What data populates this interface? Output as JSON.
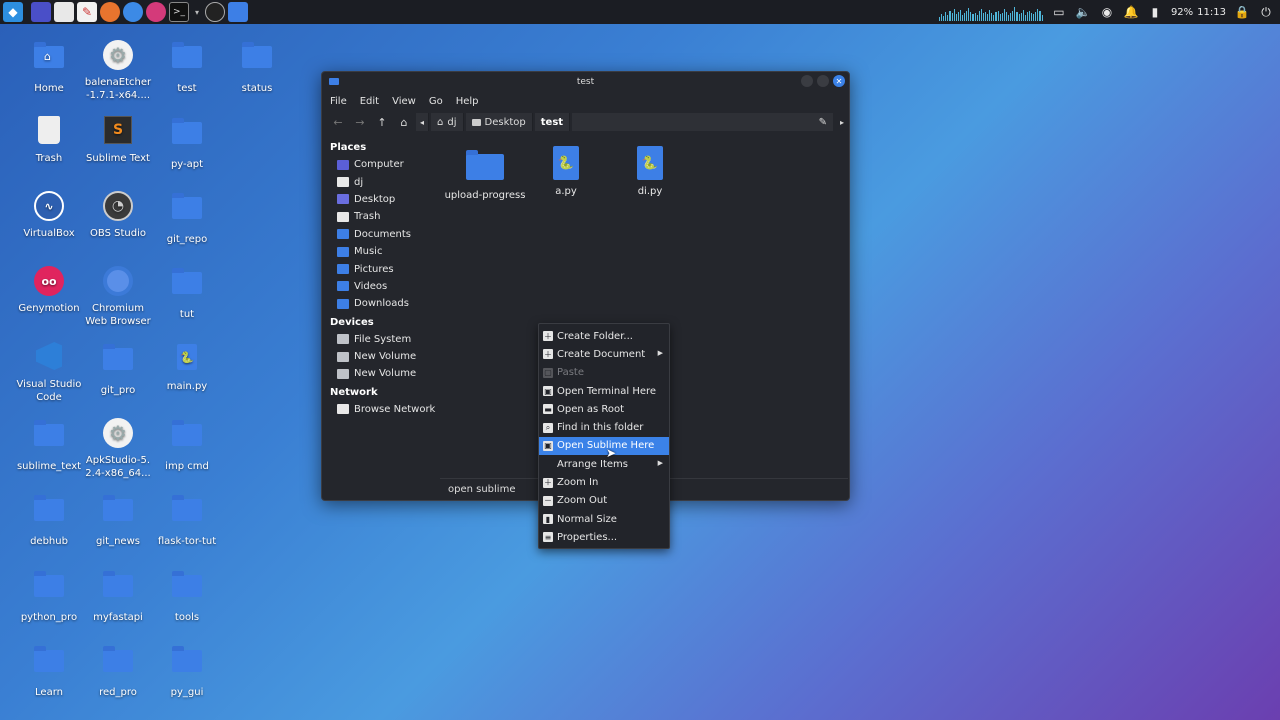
{
  "panel": {
    "launchers": [
      "start-menu-icon",
      "workspace-icon",
      "file-manager-icon",
      "text-editor-icon",
      "firefox-icon",
      "chromium-icon",
      "firefox-dev-icon",
      "terminal-icon",
      "chevron-down-icon",
      "obs-icon",
      "folder-icon"
    ],
    "battery": "92%",
    "time": "11:13"
  },
  "desktop": {
    "icons": [
      {
        "label": "Home",
        "type": "home-folder"
      },
      {
        "label": "balenaEtcher\n-1.7.1-x64....",
        "type": "gear"
      },
      {
        "label": "test",
        "type": "folder"
      },
      {
        "label": "status",
        "type": "folder"
      },
      {
        "label": "Trash",
        "type": "trash"
      },
      {
        "label": "Sublime Text",
        "type": "sublime"
      },
      {
        "label": "py-apt",
        "type": "folder"
      },
      {
        "label": "VirtualBox",
        "type": "virtualbox"
      },
      {
        "label": "OBS Studio",
        "type": "obs"
      },
      {
        "label": "git_repo",
        "type": "folder"
      },
      {
        "label": "Genymotion",
        "type": "genymotion"
      },
      {
        "label": "Chromium\nWeb Browser",
        "type": "chromium"
      },
      {
        "label": "tut",
        "type": "folder"
      },
      {
        "label": "Visual Studio\nCode",
        "type": "vscode"
      },
      {
        "label": "git_pro",
        "type": "folder"
      },
      {
        "label": "main.py",
        "type": "python"
      },
      {
        "label": "sublime_text",
        "type": "folder"
      },
      {
        "label": "ApkStudio-5.\n2.4-x86_64...",
        "type": "gear"
      },
      {
        "label": "imp cmd",
        "type": "folder"
      },
      {
        "label": "debhub",
        "type": "folder"
      },
      {
        "label": "git_news",
        "type": "folder"
      },
      {
        "label": "flask-tor-tut",
        "type": "folder"
      },
      {
        "label": "python_pro",
        "type": "folder"
      },
      {
        "label": "myfastapi",
        "type": "folder"
      },
      {
        "label": "tools",
        "type": "folder"
      },
      {
        "label": "Learn",
        "type": "folder"
      },
      {
        "label": "red_pro",
        "type": "folder"
      },
      {
        "label": "py_gui",
        "type": "folder"
      }
    ]
  },
  "window": {
    "title": "test",
    "menu": [
      "File",
      "Edit",
      "View",
      "Go",
      "Help"
    ],
    "breadcrumbs": [
      "dj",
      "Desktop",
      "test"
    ],
    "sidebar": {
      "places_heading": "Places",
      "places": [
        "Computer",
        "dj",
        "Desktop",
        "Trash",
        "Documents",
        "Music",
        "Pictures",
        "Videos",
        "Downloads"
      ],
      "devices_heading": "Devices",
      "devices": [
        "File System",
        "New Volume",
        "New Volume"
      ],
      "network_heading": "Network",
      "network": [
        "Browse Network"
      ]
    },
    "files": [
      "upload-progress",
      "a.py",
      "di.py"
    ],
    "status_text": "open sublime"
  },
  "context_menu": {
    "items": [
      {
        "label": "Create Folder...",
        "icon": "plus-icon",
        "state": "normal"
      },
      {
        "label": "Create Document",
        "icon": "plus-icon",
        "state": "normal",
        "submenu": true
      },
      {
        "label": "Paste",
        "icon": "paste-icon",
        "state": "disabled"
      },
      {
        "label": "Open Terminal Here",
        "icon": "terminal-icon",
        "state": "normal"
      },
      {
        "label": "Open as Root",
        "icon": "folder-icon",
        "state": "normal"
      },
      {
        "label": "Find in this folder",
        "icon": "search-icon",
        "state": "normal"
      },
      {
        "label": "Open Sublime Here",
        "icon": "sublime-icon",
        "state": "highlighted"
      },
      {
        "label": "Arrange Items",
        "icon": "",
        "state": "normal",
        "submenu": true
      },
      {
        "label": "Zoom In",
        "icon": "zoom-in-icon",
        "state": "normal"
      },
      {
        "label": "Zoom Out",
        "icon": "zoom-out-icon",
        "state": "normal"
      },
      {
        "label": "Normal Size",
        "icon": "normal-size-icon",
        "state": "normal"
      },
      {
        "label": "Properties...",
        "icon": "properties-icon",
        "state": "normal"
      }
    ]
  },
  "colors": {
    "accent": "#3b82e8",
    "folder": "#3d7fe6",
    "panel": "#1b1d23",
    "window_bg": "#24262c"
  }
}
